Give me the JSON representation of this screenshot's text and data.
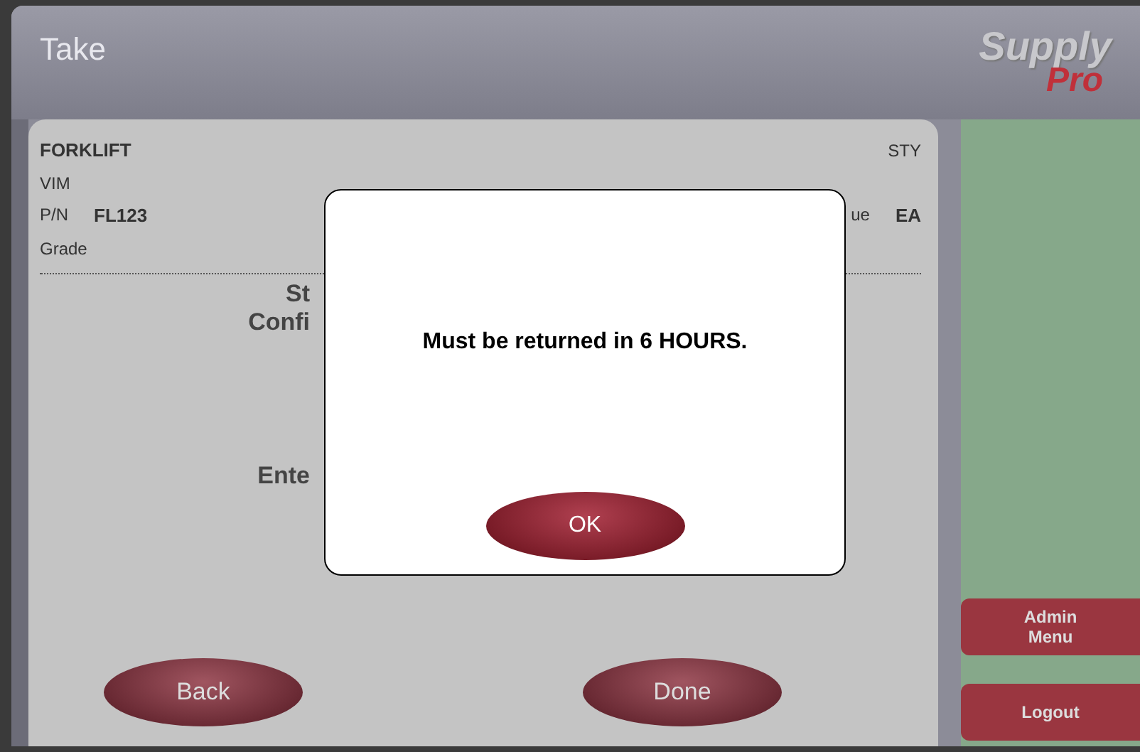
{
  "header": {
    "title": "Take",
    "logo": {
      "line_1": "Supply",
      "line_2": "Pro"
    }
  },
  "item": {
    "name": "FORKLIFT",
    "code": "STY",
    "line_2": "VIM",
    "pn_label": "P/N",
    "pn_value": "FL123",
    "unit_label": "ue",
    "unit_value": "EA",
    "line_4": "Grade"
  },
  "behind_texts": [
    "St",
    "Confi",
    "Ente"
  ],
  "buttons": [
    "Back",
    "Done"
  ],
  "sidebar": {
    "buttons": [
      "Admin Menu",
      "Logout"
    ]
  },
  "dialog": {
    "message": "Must be returned in 6 HOURS.",
    "button": "OK"
  }
}
